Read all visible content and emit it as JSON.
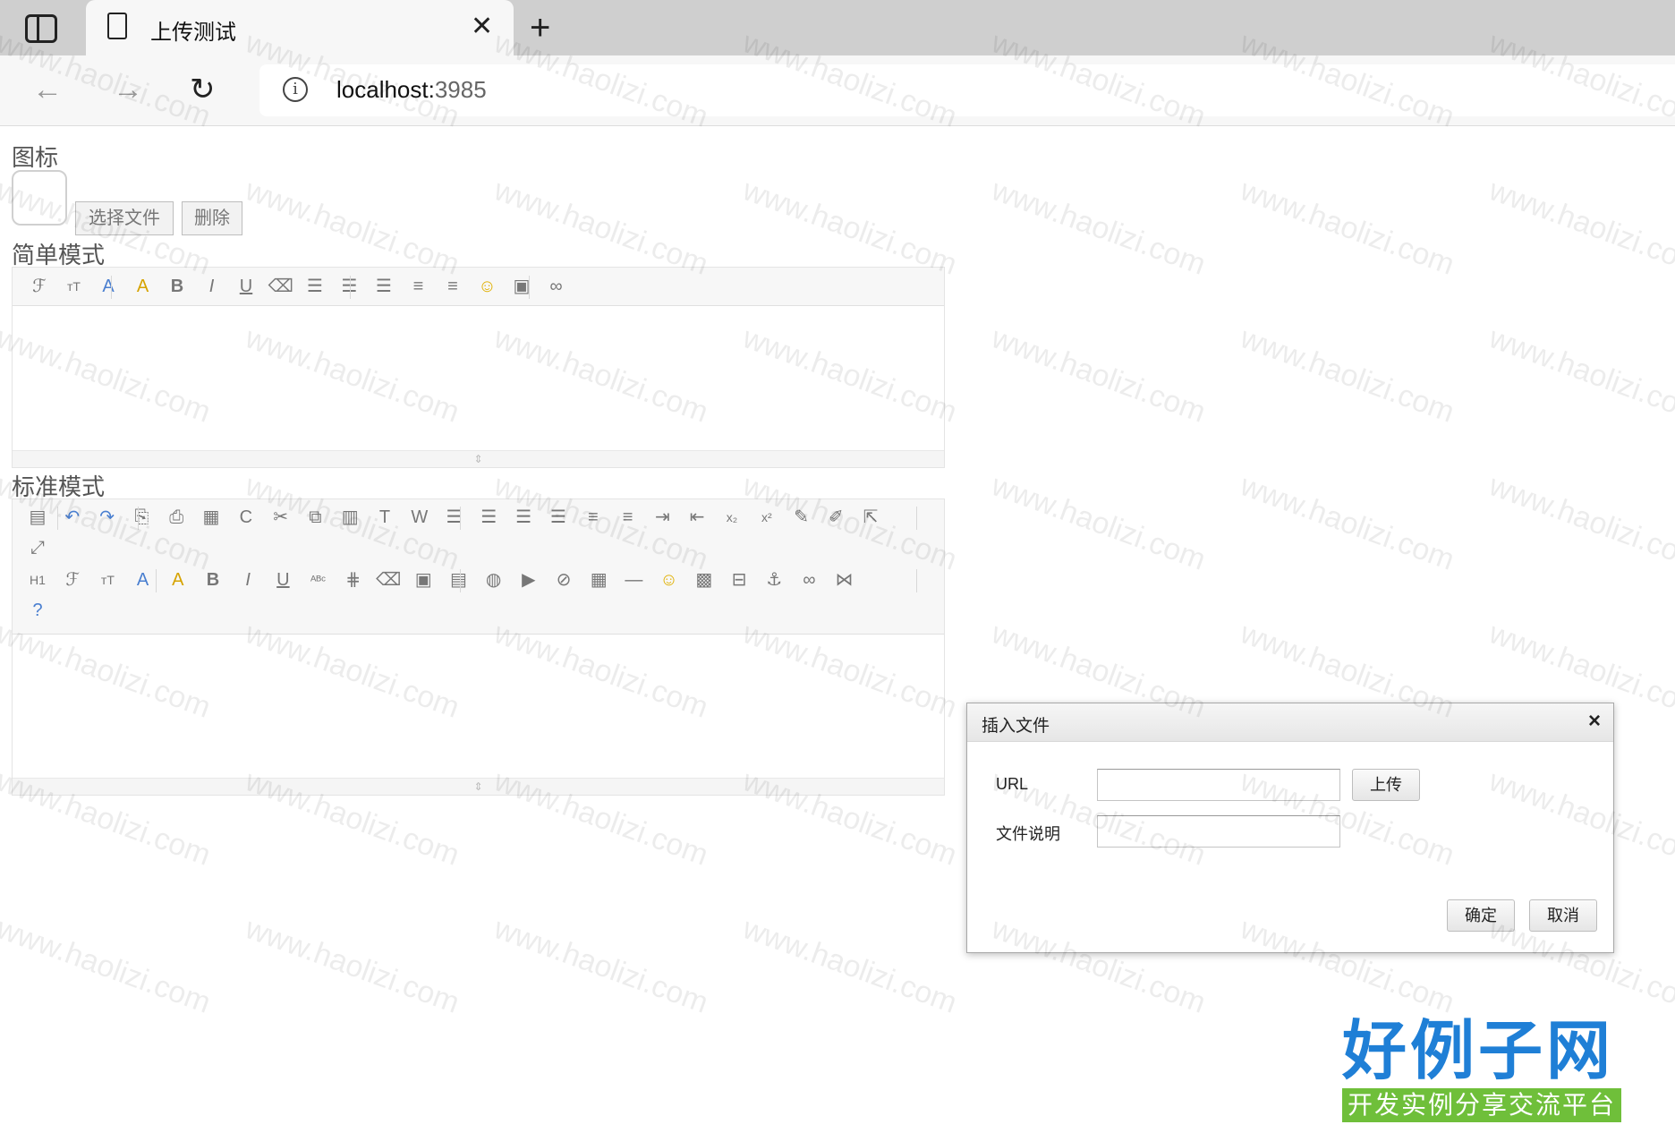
{
  "browser": {
    "tab_title": "上传测试",
    "url_host": "localhost:",
    "url_port": "3985"
  },
  "page": {
    "icon_label": "图标",
    "choose_file_button": "选择文件",
    "delete_button": "删除",
    "simple_mode_label": "简单模式",
    "standard_mode_label": "标准模式"
  },
  "dialog": {
    "title": "插入文件",
    "url_label": "URL",
    "upload_button": "上传",
    "description_label": "文件说明",
    "ok_button": "确定",
    "cancel_button": "取消"
  },
  "watermark": "www.haolizi.com",
  "logo": {
    "title": "好例子网",
    "subtitle": "开发实例分享交流平台"
  },
  "icons": {
    "simple_toolbar": [
      "font-family-icon",
      "font-size-icon",
      "font-color-icon",
      "highlight-icon",
      "bold-icon",
      "italic-icon",
      "underline-icon",
      "eraser-icon",
      "align-left-icon",
      "align-center-icon",
      "align-right-icon",
      "ordered-list-icon",
      "unordered-list-icon",
      "emoticon-icon",
      "image-icon",
      "link-icon"
    ],
    "standard_toolbar": [
      "source-icon",
      "undo-icon",
      "redo-icon",
      "preview-icon",
      "print-icon",
      "template-icon",
      "code-icon",
      "cut-icon",
      "copy-icon",
      "paste-icon",
      "paste-text-icon",
      "paste-word-icon",
      "justify-left-icon",
      "justify-center-icon",
      "justify-right-icon",
      "justify-full-icon",
      "ordered-list-icon",
      "unordered-list-icon",
      "indent-icon",
      "outdent-icon",
      "subscript-icon",
      "superscript-icon",
      "clear-html-icon",
      "quick-format-icon",
      "select-all-icon",
      "fullscreen-icon",
      "heading-icon",
      "font-family-icon",
      "font-size-icon",
      "font-color-icon",
      "highlight-icon",
      "bold-icon",
      "italic-icon",
      "underline-icon",
      "strikethrough-icon",
      "line-height-icon",
      "remove-format-icon",
      "image-icon",
      "multi-image-icon",
      "flash-icon",
      "media-icon",
      "insert-file-icon",
      "table-icon",
      "horizontal-rule-icon",
      "emoticon-icon",
      "baidu-map-icon",
      "page-break-icon",
      "anchor-icon",
      "link-icon",
      "unlink-icon",
      "help-icon"
    ]
  }
}
